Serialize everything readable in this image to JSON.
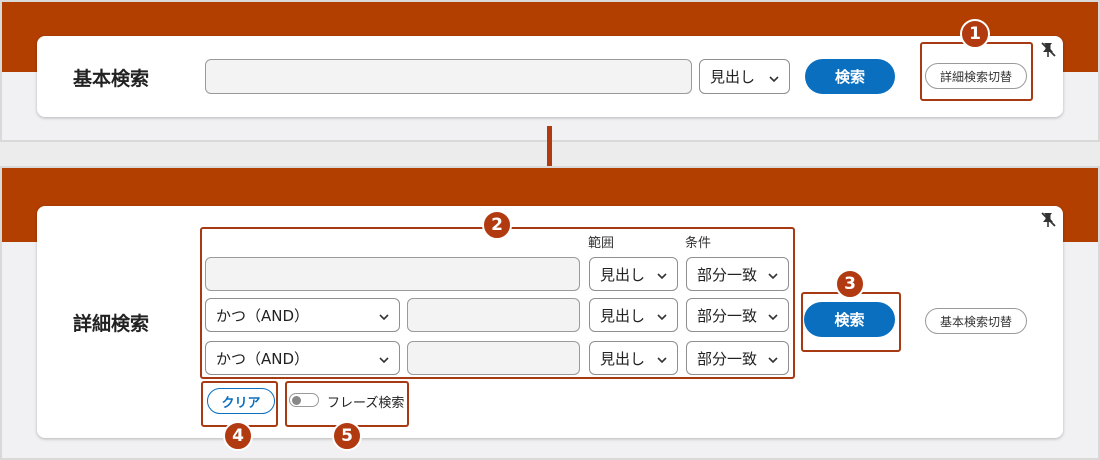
{
  "basic": {
    "title": "基本検索",
    "search_input_value": "",
    "scope_select": "見出し",
    "search_button": "検索",
    "switch_button": "詳細検索切替"
  },
  "advanced": {
    "title": "詳細検索",
    "col_scope_label": "範囲",
    "col_condition_label": "条件",
    "rows": [
      {
        "operator": "",
        "scope": "見出し",
        "condition": "部分一致"
      },
      {
        "operator": "かつ（AND）",
        "scope": "見出し",
        "condition": "部分一致"
      },
      {
        "operator": "かつ（AND）",
        "scope": "見出し",
        "condition": "部分一致"
      }
    ],
    "search_button": "検索",
    "switch_button": "基本検索切替",
    "clear_button": "クリア",
    "phrase_toggle_label": "フレーズ検索",
    "phrase_toggle_on": false
  },
  "annotations": [
    "1",
    "2",
    "3",
    "4",
    "5"
  ],
  "colors": {
    "band": "#b23f00",
    "accent": "#0a6fbf",
    "annotation": "#a73a12"
  },
  "icons": {
    "pin": "unpin-icon",
    "chevron": "chevron-down-icon",
    "arrow": "arrow-down-icon"
  }
}
